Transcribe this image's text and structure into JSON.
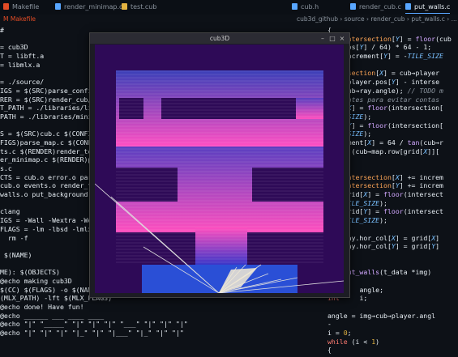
{
  "tabs": [
    {
      "label": "Makefile",
      "icon": "makefile-icon",
      "color": "#e34c26"
    },
    {
      "label": "render_minimap.c",
      "icon": "c-file-icon",
      "color": "#58a6ff"
    },
    {
      "label": "test.cub",
      "icon": "cub-file-icon",
      "color": "#e3b341"
    },
    {
      "label": "cub.h",
      "icon": "c-file-icon",
      "color": "#58a6ff"
    },
    {
      "label": "render_cub.c",
      "icon": "c-file-icon",
      "color": "#58a6ff"
    },
    {
      "label": "put_walls.c",
      "icon": "c-file-icon",
      "color": "#58a6ff"
    }
  ],
  "left_breadcrumb": "M  Makefile",
  "right_breadcrumb": "cub3d_github › source › render_cub › put_walls.c › ...",
  "left_lines": [
    [
      [
        "mk",
        "#"
      ]
    ],
    [],
    [
      [
        "mk",
        "= cub3D"
      ]
    ],
    [
      [
        "mk",
        "T = libft.a"
      ]
    ],
    [
      [
        "mk",
        "= libmlx.a"
      ]
    ],
    [],
    [
      [
        "mk",
        "= ./source/"
      ]
    ],
    [
      [
        "mk",
        "IGS = $(SRC)parse_config/"
      ]
    ],
    [
      [
        "mk",
        "RER = $(SRC)render_cub/"
      ]
    ],
    [
      [
        "mk",
        "T_PATH = ./libraries/libft/"
      ]
    ],
    [
      [
        "mk",
        "PATH = ./libraries/minilibx/"
      ]
    ],
    [],
    [
      [
        "mk",
        "S = $(SRC)cub.c $(CONFIGS)"
      ]
    ],
    [
      [
        "mk",
        "FIGS)parse_map.c $(CONFIGS)"
      ]
    ],
    [
      [
        "mk",
        "ts.c $(RENDER)render_tools"
      ]
    ],
    [
      [
        "mk",
        "er_minimap.c $(RENDER)put_"
      ]
    ],
    [
      [
        "mk",
        "s.c"
      ]
    ],
    [
      [
        "mk",
        "CTS = cub.o error.o parse"
      ]
    ],
    [
      [
        "mk",
        "cub.o events.o render_tool"
      ]
    ],
    [
      [
        "mk",
        "walls.o put_background.o"
      ]
    ],
    [],
    [
      [
        "mk",
        "clang"
      ]
    ],
    [
      [
        "mk",
        "IGS = -Wall -Wextra -Werror"
      ]
    ],
    [
      [
        "mk",
        "FLAGS = -lm -lbsd -lmlx -lX"
      ]
    ],
    [
      [
        "mk",
        "  rm -f"
      ]
    ],
    [],
    [
      [
        "mk",
        " $(NAME)"
      ]
    ],
    [],
    [
      [
        "mk",
        "ME): $(OBJECTS)"
      ]
    ],
    [
      [
        "mk",
        "@echo making cub3D"
      ]
    ],
    [
      [
        "mk",
        "$(CC) $(FLAGS) -o $(NAME) $(OBJECTS) -L $(LIBFT_PATH) -L $"
      ]
    ],
    [
      [
        "mk",
        "(MLX_PATH) -lft $(MLX_FLAGS)"
      ]
    ],
    [
      [
        "mk",
        "@echo done! Have fun!"
      ]
    ],
    [
      [
        "mk",
        "@echo ______ ___ ____ ____"
      ]
    ],
    [
      [
        "mk",
        "@echo \"|\" \"_____\" \"|\" \"|\" \"|\" \"___\" \"|\" \"|\" \"|\""
      ]
    ],
    [
      [
        "mk",
        "@echo \"|\" \"|\" \"|\" \"|_\" \"|\" \"|___\" \"|_\" \"|\" \"|\""
      ]
    ]
  ],
  "right_lines": [
    [
      [
        "mk",
        "{"
      ]
    ],
    [
      [
        "mk",
        "    "
      ],
      [
        "vr",
        "intersection"
      ],
      [
        "mk",
        "["
      ],
      [
        "it",
        "Y"
      ],
      [
        "mk",
        "] = "
      ],
      [
        "fn",
        "floor"
      ],
      [
        "mk",
        "(cub"
      ]
    ],
    [
      [
        "mk",
        "    pos["
      ],
      [
        "it",
        "Y"
      ],
      [
        "mk",
        "] / 64) * 64 - 1;"
      ]
    ],
    [
      [
        "mk",
        "    increment["
      ],
      [
        "it",
        "Y"
      ],
      [
        "mk",
        "] = -"
      ],
      [
        "it",
        "TILE_SIZE"
      ]
    ],
    [
      [
        "mk",
        "}"
      ]
    ],
    [
      [
        "vr",
        "intersection"
      ],
      [
        "mk",
        "["
      ],
      [
        "it",
        "X"
      ],
      [
        "mk",
        "] = cub→player"
      ]
    ],
    [
      [
        "mk",
        "(cub→player.pos["
      ],
      [
        "it",
        "Y"
      ],
      [
        "mk",
        "] - interse"
      ]
    ],
    [
      [
        "fn",
        "tan"
      ],
      [
        "mk",
        "(cub→ray.angle); "
      ],
      [
        "cm",
        "// TODO m"
      ]
    ],
    [
      [
        "cm",
        "tangentes para evitar contas"
      ]
    ],
    [
      [
        "mk",
        "grid["
      ],
      [
        "it",
        "X"
      ],
      [
        "mk",
        "] = "
      ],
      [
        "fn",
        "floor"
      ],
      [
        "mk",
        "(intersection["
      ]
    ],
    [
      [
        "it",
        "TILE_SIZE"
      ],
      [
        "mk",
        ");"
      ]
    ],
    [
      [
        "mk",
        "grid["
      ],
      [
        "it",
        "Y"
      ],
      [
        "mk",
        "] = "
      ],
      [
        "fn",
        "floor"
      ],
      [
        "mk",
        "(intersection["
      ]
    ],
    [
      [
        "it",
        "TILE_SIZE"
      ],
      [
        "mk",
        ");"
      ]
    ],
    [
      [
        "mk",
        "increment["
      ],
      [
        "it",
        "X"
      ],
      [
        "mk",
        "] = 64 / "
      ],
      [
        "fn",
        "tan"
      ],
      [
        "mk",
        "(cub→r"
      ]
    ],
    [
      [
        "kw",
        "while"
      ],
      [
        "mk",
        " (cub→map.row[grid["
      ],
      [
        "it",
        "X"
      ],
      [
        "mk",
        "]]["
      ]
    ],
    [
      [
        "st",
        "'0'"
      ],
      [
        "mk",
        ")"
      ]
    ],
    [
      [
        "mk",
        "{"
      ]
    ],
    [
      [
        "mk",
        "    "
      ],
      [
        "vr",
        "intersection"
      ],
      [
        "mk",
        "["
      ],
      [
        "it",
        "X"
      ],
      [
        "mk",
        "] += increm"
      ]
    ],
    [
      [
        "mk",
        "    "
      ],
      [
        "vr",
        "intersection"
      ],
      [
        "mk",
        "["
      ],
      [
        "it",
        "Y"
      ],
      [
        "mk",
        "] += increm"
      ]
    ],
    [
      [
        "mk",
        "    grid["
      ],
      [
        "it",
        "X"
      ],
      [
        "mk",
        "] = "
      ],
      [
        "fn",
        "floor"
      ],
      [
        "mk",
        "(intersect"
      ]
    ],
    [
      [
        "mk",
        "    "
      ],
      [
        "it",
        "TILE_SIZE"
      ],
      [
        "mk",
        ");"
      ]
    ],
    [
      [
        "mk",
        "    grid["
      ],
      [
        "it",
        "Y"
      ],
      [
        "mk",
        "] = "
      ],
      [
        "fn",
        "floor"
      ],
      [
        "mk",
        "(intersect"
      ]
    ],
    [
      [
        "mk",
        "    "
      ],
      [
        "it",
        "TILE_SIZE"
      ],
      [
        "mk",
        ");"
      ]
    ],
    [
      [
        "mk",
        "}"
      ]
    ],
    [
      [
        "mk",
        "cub→ray.hor_col["
      ],
      [
        "it",
        "X"
      ],
      [
        "mk",
        "] = grid["
      ],
      [
        "it",
        "X"
      ],
      [
        "mk",
        "]"
      ]
    ],
    [
      [
        "mk",
        "cub→ray.hor_col["
      ],
      [
        "it",
        "Y"
      ],
      [
        "mk",
        "] = grid["
      ],
      [
        "it",
        "Y"
      ],
      [
        "mk",
        "]"
      ]
    ],
    [],
    [],
    [
      [
        "mk",
        "    "
      ],
      [
        "fn",
        "put_walls"
      ],
      [
        "mk",
        "(t_data *img)"
      ]
    ],
    [],
    [
      [
        "kw",
        "float"
      ],
      [
        "mk",
        "   angle;"
      ]
    ],
    [
      [
        "kw",
        "int"
      ],
      [
        "mk",
        "     i;"
      ]
    ],
    [],
    [
      [
        "mk",
        "angle = img→cub→player.angl"
      ]
    ],
    [
      [
        "mk",
        "-"
      ]
    ],
    [
      [
        "mk",
        "i = "
      ],
      [
        "yl",
        "0"
      ],
      [
        "mk",
        ";"
      ]
    ],
    [
      [
        "kw",
        "while"
      ],
      [
        "mk",
        " (i < "
      ],
      [
        "yl",
        "1"
      ],
      [
        "mk",
        ")"
      ]
    ],
    [
      [
        "mk",
        "{"
      ]
    ]
  ],
  "gutter": [
    "",
    "",
    "",
    "",
    "",
    "",
    "",
    "",
    "",
    "",
    "",
    "",
    "",
    "",
    "",
    "",
    "",
    "",
    "",
    "",
    "",
    "",
    "",
    "",
    "",
    "",
    "",
    "",
    "",
    "",
    "",
    "",
    "",
    "",
    "",
    "",
    "",
    "",
    ""
  ],
  "window": {
    "title": "cub3D",
    "minimize": "–",
    "maximize": "□",
    "close": "×",
    "colors": {
      "background": "#2e0a57",
      "wall_top": "#3d2d9e",
      "wall_pink": "#ff4fbf",
      "floor": "#2b4fd8",
      "ray": "#d9d9d9"
    }
  }
}
